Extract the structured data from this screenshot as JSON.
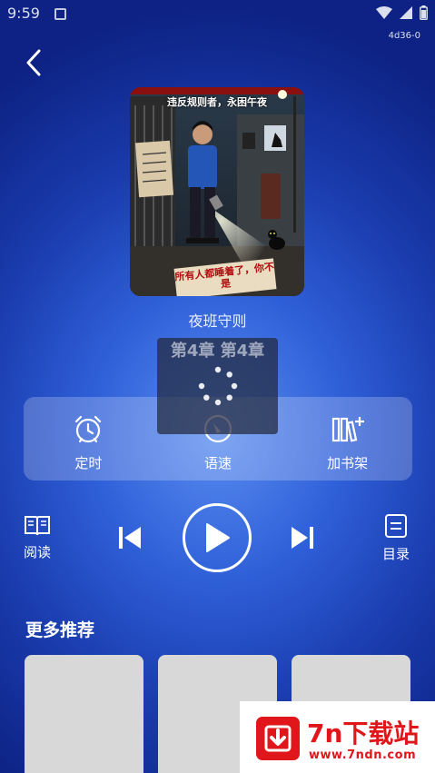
{
  "status_bar": {
    "time": "9:59"
  },
  "version": "4d36-0",
  "cover": {
    "subtitle": "违反规则者，永困午夜",
    "note": "所有人都睡着了，你不是"
  },
  "book_title": "夜班守则",
  "loading": {
    "chapter": "第4章  第4章"
  },
  "controls": [
    {
      "label": "定时",
      "icon": "alarm-clock-icon"
    },
    {
      "label": "语速",
      "icon": "speed-dial-icon"
    },
    {
      "label": "加书架",
      "icon": "add-bookshelf-icon"
    }
  ],
  "player": {
    "read_label": "阅读",
    "toc_label": "目录"
  },
  "more_section": {
    "title": "更多推荐"
  },
  "watermark": {
    "title": "7n下载站",
    "url": "www.7ndn.com"
  }
}
